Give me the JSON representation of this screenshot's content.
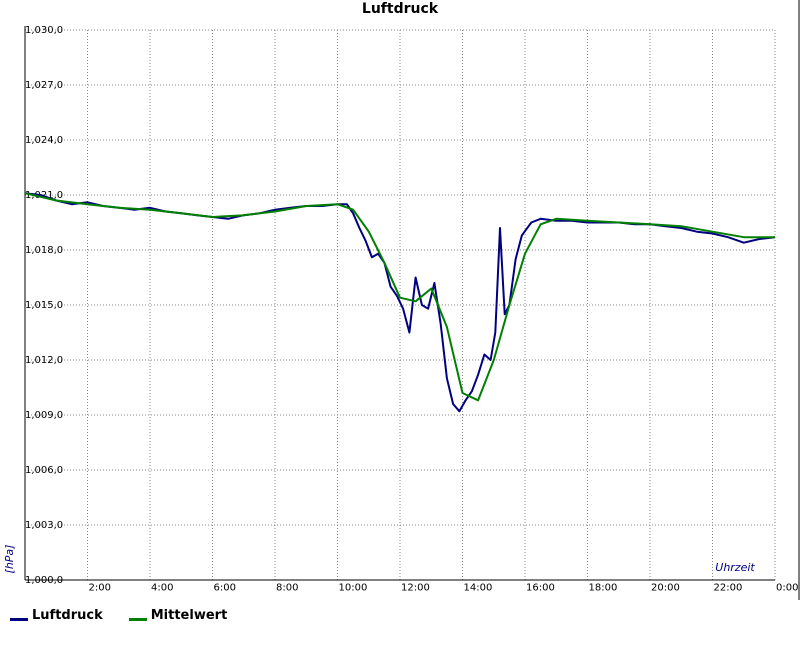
{
  "chart_data": {
    "type": "line",
    "title": "Luftdruck",
    "xlabel": "Uhrzeit",
    "ylabel": "[hPa]",
    "xlim": [
      0,
      24
    ],
    "ylim": [
      1000,
      1030
    ],
    "x_ticks": [
      "",
      "2:00",
      "4:00",
      "6:00",
      "8:00",
      "10:00",
      "12:00",
      "14:00",
      "16:00",
      "18:00",
      "20:00",
      "22:00",
      "0:00"
    ],
    "y_ticks": [
      "1,000,0",
      "1,003,0",
      "1,006,0",
      "1,009,0",
      "1,012,0",
      "1,015,0",
      "1,018,0",
      "1,021,0",
      "1,024,0",
      "1,027,0",
      "1,030,0"
    ],
    "grid": true,
    "legend_position": "bottom-left",
    "series": [
      {
        "name": "Luftdruck",
        "color": "#000080",
        "x": [
          0,
          0.5,
          1,
          1.5,
          2,
          2.5,
          3,
          3.5,
          4,
          4.5,
          5,
          5.5,
          6,
          6.5,
          7,
          7.5,
          8,
          8.5,
          9,
          9.5,
          10,
          10.3,
          10.5,
          10.7,
          10.9,
          11.1,
          11.3,
          11.5,
          11.7,
          11.9,
          12.1,
          12.3,
          12.5,
          12.7,
          12.9,
          13.1,
          13.3,
          13.5,
          13.7,
          13.9,
          14.1,
          14.3,
          14.5,
          14.7,
          14.9,
          15.05,
          15.2,
          15.35,
          15.5,
          15.7,
          15.9,
          16.2,
          16.5,
          17,
          17.5,
          18,
          18.5,
          19,
          19.5,
          20,
          20.5,
          21,
          21.5,
          22,
          22.5,
          23,
          23.5,
          24
        ],
        "values": [
          1021.1,
          1021.0,
          1020.7,
          1020.5,
          1020.6,
          1020.4,
          1020.3,
          1020.2,
          1020.3,
          1020.1,
          1020.0,
          1019.9,
          1019.8,
          1019.7,
          1019.9,
          1020.0,
          1020.2,
          1020.3,
          1020.4,
          1020.4,
          1020.5,
          1020.5,
          1020.0,
          1019.2,
          1018.5,
          1017.6,
          1017.8,
          1017.3,
          1016.0,
          1015.5,
          1014.8,
          1013.5,
          1016.5,
          1015.0,
          1014.8,
          1016.2,
          1014.0,
          1011.0,
          1009.6,
          1009.2,
          1009.8,
          1010.3,
          1011.2,
          1012.3,
          1012.0,
          1013.5,
          1019.2,
          1014.5,
          1015.0,
          1017.5,
          1018.8,
          1019.5,
          1019.7,
          1019.6,
          1019.6,
          1019.5,
          1019.5,
          1019.5,
          1019.4,
          1019.4,
          1019.3,
          1019.2,
          1019.0,
          1018.9,
          1018.7,
          1018.4,
          1018.6,
          1018.7
        ]
      },
      {
        "name": "Mittelwert",
        "color": "#008000",
        "x": [
          0,
          1,
          2,
          3,
          4,
          5,
          6,
          7,
          8,
          9,
          10,
          10.5,
          11,
          11.5,
          12,
          12.5,
          13,
          13.5,
          14,
          14.5,
          15,
          15.5,
          16,
          16.5,
          17,
          18,
          19,
          20,
          21,
          22,
          23,
          24
        ],
        "values": [
          1021.1,
          1020.7,
          1020.5,
          1020.3,
          1020.2,
          1020.0,
          1019.8,
          1019.9,
          1020.1,
          1020.4,
          1020.5,
          1020.2,
          1019.0,
          1017.3,
          1015.4,
          1015.2,
          1015.9,
          1013.8,
          1010.2,
          1009.8,
          1012.0,
          1015.0,
          1017.8,
          1019.4,
          1019.7,
          1019.6,
          1019.5,
          1019.4,
          1019.3,
          1019.0,
          1018.7,
          1018.7
        ]
      }
    ]
  }
}
